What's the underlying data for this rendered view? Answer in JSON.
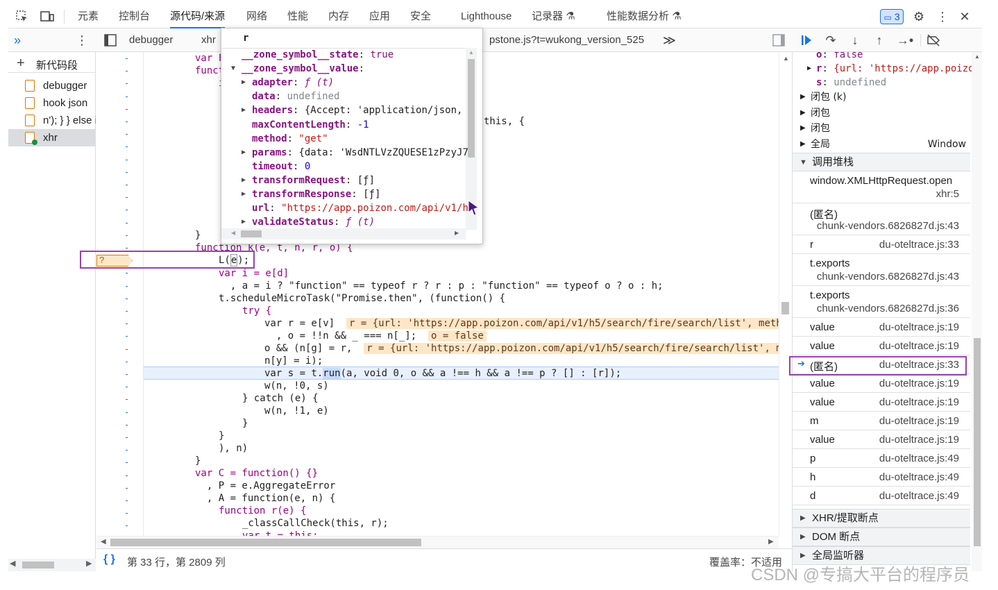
{
  "top_tabs": [
    "元素",
    "控制台",
    "源代码/来源",
    "网络",
    "性能",
    "内存",
    "应用",
    "安全",
    "Lighthouse",
    "记录器",
    "性能数据分析"
  ],
  "issues_badge": "3",
  "sub_tabs": {
    "debugger": "debugger",
    "xhr": "xhr",
    "pstone": "pstone.js?t=wukong_version_525",
    "more": "≫"
  },
  "navigator": {
    "new_snippet": "新代码段",
    "items": [
      "debugger",
      "hook json",
      "n'); } } else i",
      "xhr"
    ]
  },
  "popover": {
    "title": "r",
    "lines": [
      {
        "key": "__zone_symbol__state",
        "value": "true",
        "type": "kw",
        "expand": "none"
      },
      {
        "key": "__zone_symbol__value",
        "value": "",
        "type": "plain",
        "expand": "open"
      },
      {
        "key": "adapter",
        "value": "ƒ (t)",
        "type": "fn",
        "expand": "closed",
        "indent": true
      },
      {
        "key": "data",
        "value": "undefined",
        "type": "gray",
        "expand": "none",
        "indent": true
      },
      {
        "key": "headers",
        "value": "{Accept: 'application/json,",
        "type": "mixed",
        "expand": "closed",
        "indent": true
      },
      {
        "key": "maxContentLength",
        "value": "-1",
        "type": "num",
        "expand": "none",
        "indent": true
      },
      {
        "key": "method",
        "value": "\"get\"",
        "type": "str",
        "expand": "none",
        "indent": true
      },
      {
        "key": "params",
        "value": "{data: 'WsdNTLVzZQUESE1zPzyJ7",
        "type": "mixed",
        "expand": "closed",
        "indent": true
      },
      {
        "key": "timeout",
        "value": "0",
        "type": "num",
        "expand": "none",
        "indent": true
      },
      {
        "key": "transformRequest",
        "value": "[ƒ]",
        "type": "plain",
        "expand": "closed",
        "indent": true
      },
      {
        "key": "transformResponse",
        "value": "[ƒ]",
        "type": "plain",
        "expand": "closed",
        "indent": true
      },
      {
        "key": "url",
        "value": "\"https://app.poizon.com/api/v1/h",
        "type": "str",
        "expand": "none",
        "indent": true
      },
      {
        "key": "validateStatus",
        "value": "ƒ (t)",
        "type": "fn",
        "expand": "closed",
        "indent": true
      }
    ]
  },
  "code": {
    "peek_var": "var F",
    "peek_func": "funct",
    "peek_i": "i",
    "peek_this": "this, {",
    "close1": "}",
    "func_k": "function k(e, t, n, r, o) {",
    "L_call_pre": "L(",
    "L_call_arg": "e",
    "L_call_post": ");",
    "var_i": "var i = e[d]",
    "a_line": "  , a = i ? \"function\" == typeof r ? r : p : \"function\" == typeof o ? o : h;",
    "schedule": "t.scheduleMicroTask(\"Promise.then\", (function() {",
    "try": "try {",
    "var_r": "var r = e[v]",
    "var_r_inline": "r = {url: 'https://app.poizon.com/api/v1/h5/search/fire/search/list', metho",
    "o_line": "  , o = !!n && _ === n[_];",
    "o_inline": "o = false",
    "og_line": "o && (n[g] = r,",
    "og_inline": "r = {url: 'https://app.poizon.com/api/v1/h5/search/fire/search/list', me",
    "ny": "n[y] = i);",
    "exec_pre": "var s = t.",
    "exec_run": "run",
    "exec_post": "(a, void 0, o && a !== h && a !== p ? [] : [r]);",
    "w1": "w(n, !0, s)",
    "catch": "} catch (e) {",
    "w2": "w(n, !1, e)",
    "cb1": "}",
    "cb2": "}",
    "cb3": "), n)",
    "cb4": "}",
    "varC": "var C = function() {}",
    "P": "  , P = e.AggregateError",
    "A": "  , A = function(e, n) {",
    "fr": "function r(e) {",
    "cc": "_classCallCheck(this, r);",
    "cut": "var t = this;",
    "bp_marker": "?"
  },
  "status": {
    "position": "第 33 行，第 2809 列",
    "coverage": "覆盖率：不适用"
  },
  "sidebar": {
    "scope_lines": [
      {
        "k": "o",
        "v": "false"
      },
      {
        "k": "r",
        "v": "{url: 'https://app.poizo"
      },
      {
        "k": "s",
        "v": "undefined"
      }
    ],
    "closures": [
      {
        "label": "闭包 (k)"
      },
      {
        "label": "闭包"
      },
      {
        "label": "闭包"
      },
      {
        "label": "全局",
        "extra": "Window"
      }
    ],
    "callstack_title": "调用堆栈",
    "frames": [
      {
        "name": "window.XMLHttpRequest.open",
        "loc": "xhr:5"
      },
      {
        "name": "(匿名)",
        "loc": "chunk-vendors.6826827d.js:43"
      },
      {
        "name": "r",
        "loc": "du-oteltrace.js:33"
      },
      {
        "name": "t.exports",
        "loc": "chunk-vendors.6826827d.js:43"
      },
      {
        "name": "t.exports",
        "loc": "chunk-vendors.6826827d.js:36"
      },
      {
        "name": "value",
        "loc": "du-oteltrace.js:19"
      },
      {
        "name": "value",
        "loc": "du-oteltrace.js:19"
      },
      {
        "name": "(匿名)",
        "loc": "du-oteltrace.js:33"
      },
      {
        "name": "value",
        "loc": "du-oteltrace.js:19"
      },
      {
        "name": "value",
        "loc": "du-oteltrace.js:19"
      },
      {
        "name": "m",
        "loc": "du-oteltrace.js:19"
      },
      {
        "name": "value",
        "loc": "du-oteltrace.js:19"
      },
      {
        "name": "p",
        "loc": "du-oteltrace.js:49"
      },
      {
        "name": "h",
        "loc": "du-oteltrace.js:49"
      },
      {
        "name": "d",
        "loc": "du-oteltrace.js:49"
      }
    ],
    "xhr_breakpoints": "XHR/提取断点",
    "dom_breakpoints": "DOM 断点",
    "global_listeners": "全局监听器"
  },
  "watermark": "CSDN @专搞大平台的程序员",
  "colors": {
    "accent": "#1a73e8",
    "highlight_box": "#9b3fb5",
    "exec_line": "#e8f0fe",
    "inline_value": "#ffe6c7"
  }
}
